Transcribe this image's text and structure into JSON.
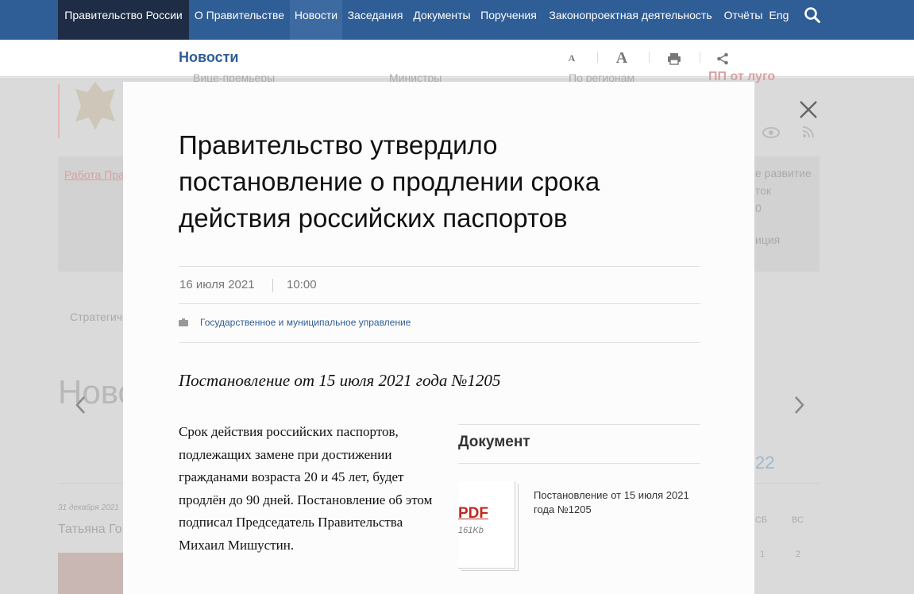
{
  "topnav": {
    "items": [
      {
        "label": "Правительство России"
      },
      {
        "label": "О Правительстве"
      },
      {
        "label": "Новости"
      },
      {
        "label": "Заседания"
      },
      {
        "label": "Документы"
      },
      {
        "label": "Поручения"
      },
      {
        "label": "Законопроектная деятельность"
      },
      {
        "label": "Отчёты"
      },
      {
        "label": "Eng"
      }
    ],
    "search_icon": "search-icon",
    "colors": {
      "bar": "#2f5d95",
      "brand_block": "#1e2c45",
      "active": "#3e6aa2"
    }
  },
  "subbar": {
    "title": "Новости",
    "tools": [
      "font-small-icon",
      "font-large-icon",
      "print-icon",
      "share-icon"
    ],
    "font_small": "A",
    "font_large": "A"
  },
  "background": {
    "texts": [
      "Вице-премьеры",
      "Министры",
      "По регионам",
      "ПП от луго",
      "Работа Пра",
      "е развитие",
      "ток",
      "0",
      "иция",
      "Стратегич",
      "Ново",
      "22",
      "31 декабря 2021",
      "Татьяна Го",
      "СБ",
      "ВС",
      "1",
      "2"
    ]
  },
  "article": {
    "title": "Правительство утвердило постановление о продлении срока действия российских паспортов",
    "date": "16 июля 2021",
    "time": "10:00",
    "tag": "Государственное и муниципальное управление",
    "lead": "Постановление от 15 июля 2021 года №1205",
    "body": "Срок действия российских паспортов, подлежащих замене при достижении гражданами возраста 20 и 45 лет, будет продлён до 90 дней. Постановление об этом подписал Председатель Правительства Михаил Мишустин.",
    "document": {
      "heading": "Документ",
      "file_type": "PDF",
      "file_size": "161Kb",
      "title": "Постановление от 15 июля 2021 года №1205"
    }
  },
  "modal": {
    "close_icon": "close-icon"
  }
}
